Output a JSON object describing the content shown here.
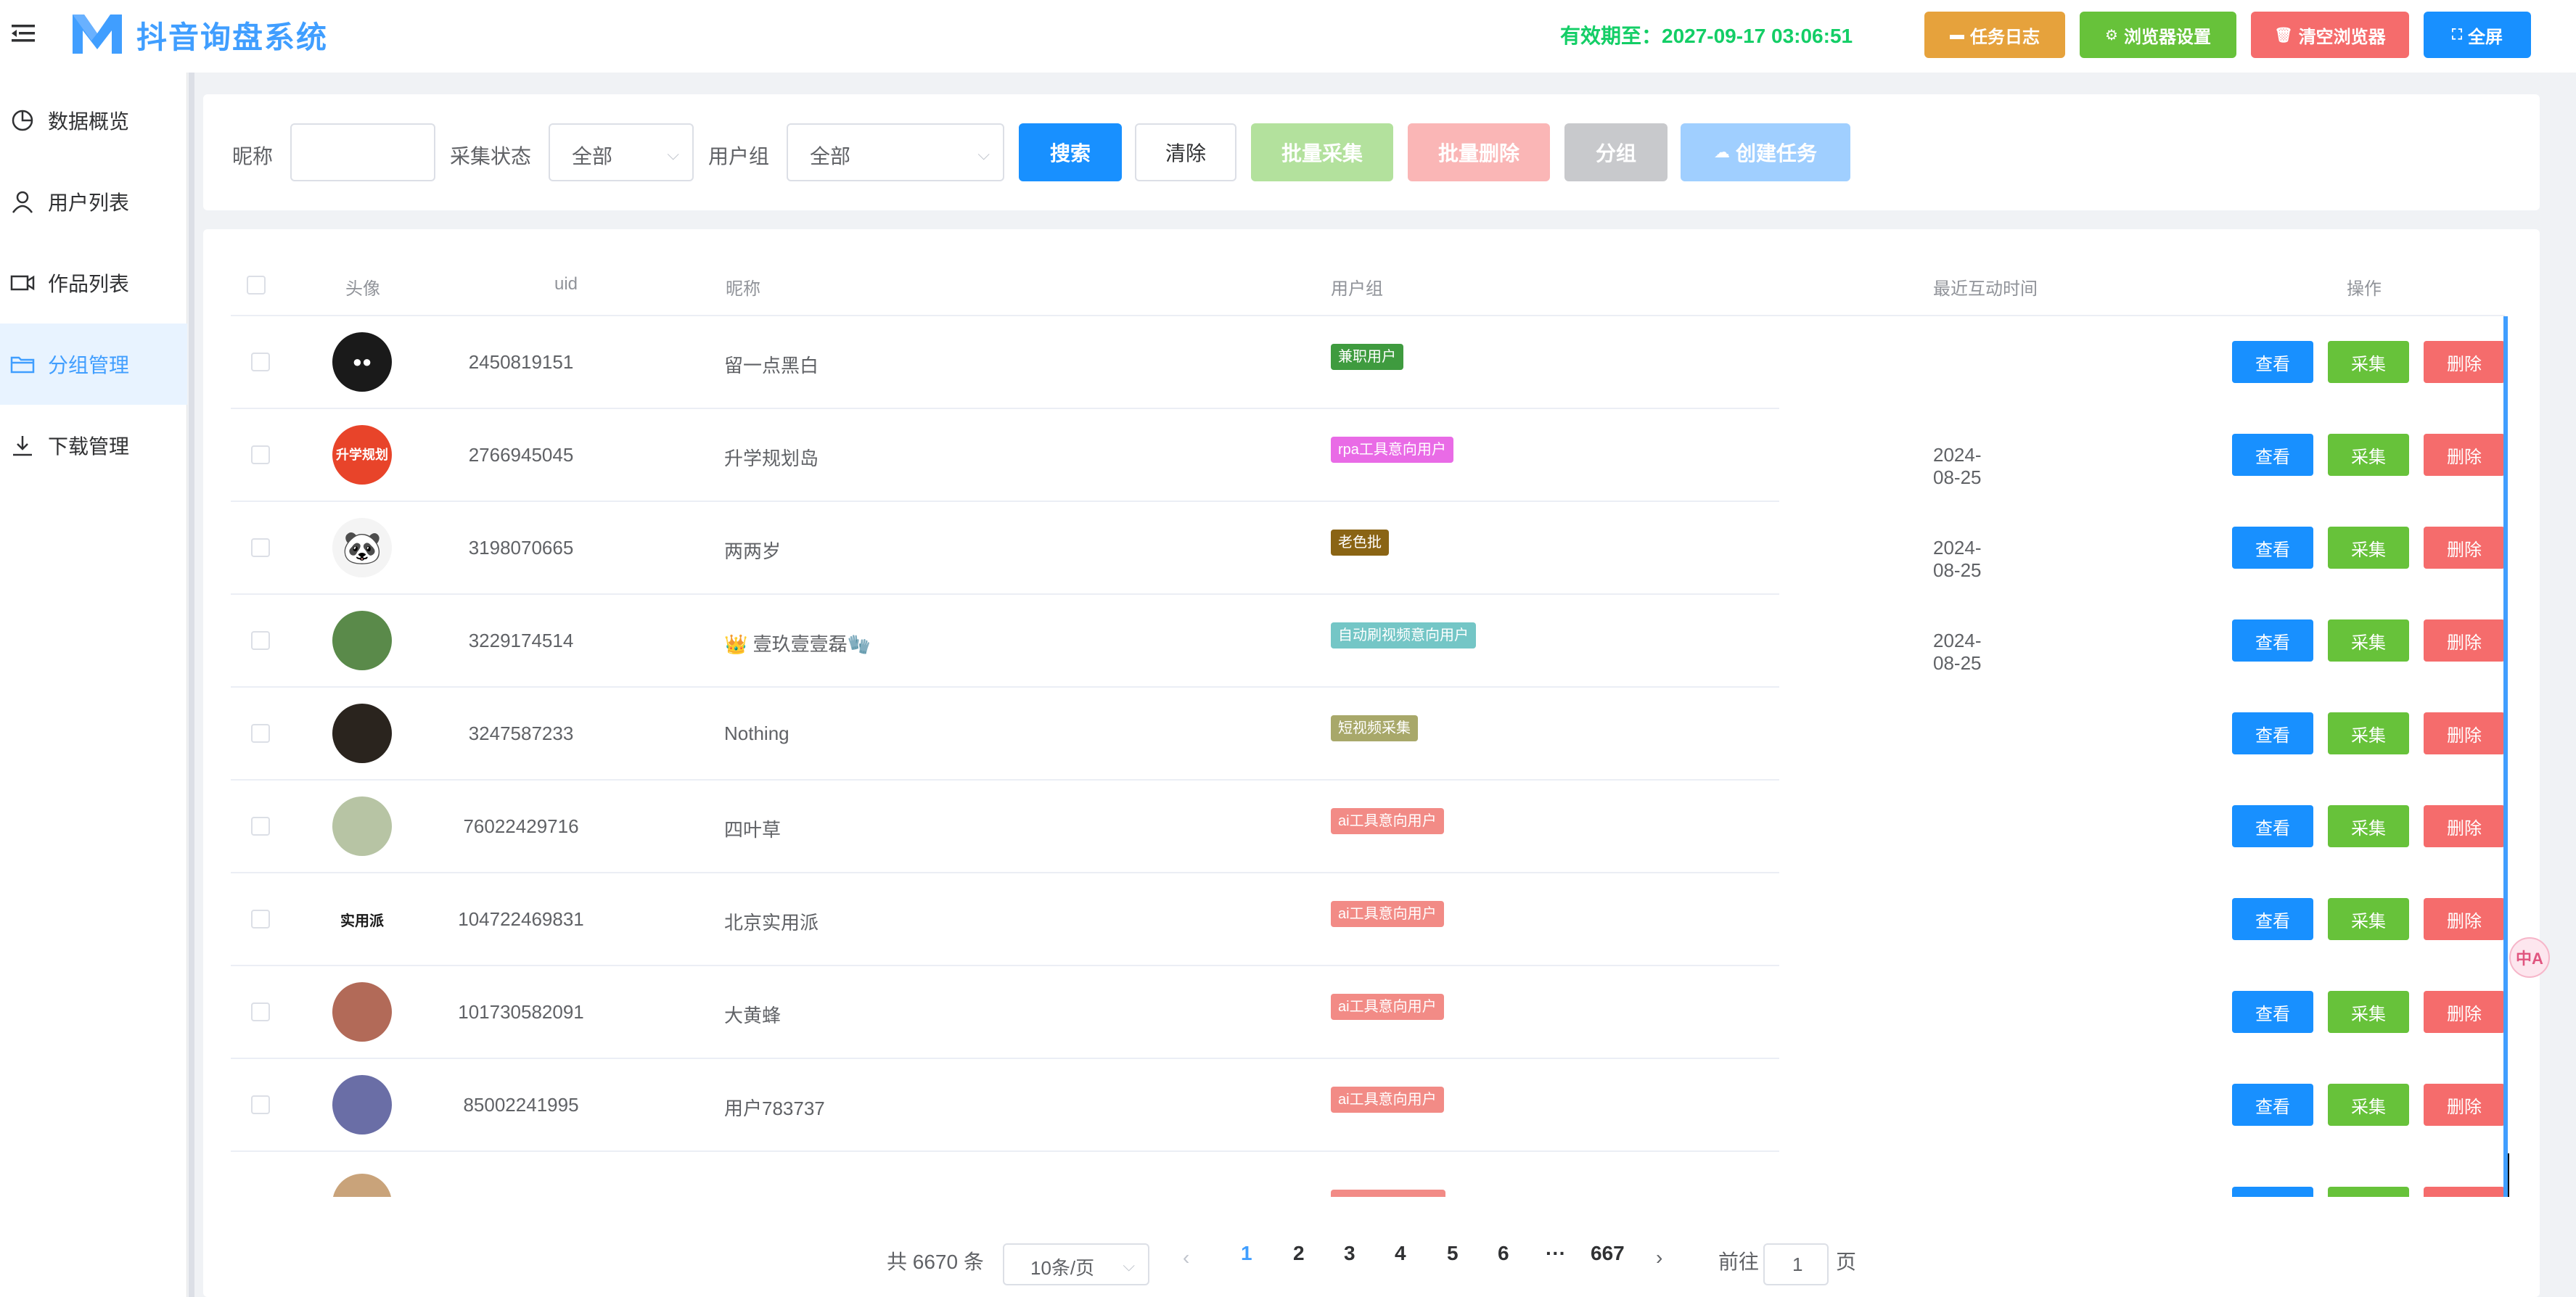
{
  "app": {
    "title": "抖音询盘系统",
    "expire_label": "有效期至：2027-09-17 03:06:51"
  },
  "header_buttons": [
    {
      "label": "任务日志",
      "icon": "monitor-icon",
      "color": "#e6a23c"
    },
    {
      "label": "浏览器设置",
      "icon": "gear-icon",
      "color": "#67c23a"
    },
    {
      "label": "清空浏览器",
      "icon": "trash-icon",
      "color": "#f56c6c"
    },
    {
      "label": "全屏",
      "icon": "fullscreen-icon",
      "color": "#1890ff"
    }
  ],
  "sidebar": {
    "items": [
      {
        "label": "数据概览",
        "icon": "pie-chart-icon"
      },
      {
        "label": "用户列表",
        "icon": "user-icon"
      },
      {
        "label": "作品列表",
        "icon": "video-icon"
      },
      {
        "label": "分组管理",
        "icon": "folder-icon",
        "active": true
      },
      {
        "label": "下载管理",
        "icon": "download-icon"
      }
    ]
  },
  "filters": {
    "nickname_label": "昵称",
    "nickname_value": "",
    "status_label": "采集状态",
    "status_value": "全部",
    "group_label": "用户组",
    "group_value": "全部",
    "search": "搜索",
    "clear": "清除",
    "batch_collect": "批量采集",
    "batch_delete": "批量删除",
    "group": "分组",
    "create_task": "创建任务"
  },
  "table": {
    "columns": [
      "头像",
      "uid",
      "昵称",
      "用户组",
      "最近互动时间",
      "操作"
    ],
    "actions": {
      "view": "查看",
      "collect": "采集",
      "delete": "删除"
    },
    "rows": [
      {
        "uid": "2450819151",
        "nick": "留一点黑白",
        "tag": "兼职用户",
        "tag_color": "#3f9b3f",
        "time": "",
        "avatar_bg": "#1a1a1a",
        "avatar_text": "●●"
      },
      {
        "uid": "2766945045",
        "nick": "升学规划岛",
        "tag": "rpa工具意向用户",
        "tag_color": "#e96be6",
        "time": "2024-08-25",
        "avatar_bg": "#e8442a",
        "avatar_text": "升学规划"
      },
      {
        "uid": "3198070665",
        "nick": "两两岁",
        "tag": "老色批",
        "tag_color": "#8a6414",
        "time": "2024-08-25",
        "avatar_bg": "#f4f4f4",
        "avatar_text": "🐼"
      },
      {
        "uid": "3229174514",
        "nick": "👑 壹玖壹壹磊🧤",
        "tag": "自动刷视频意向用户",
        "tag_color": "#74c6c6",
        "time": "2024-08-25",
        "avatar_bg": "#5a8a4a",
        "avatar_text": ""
      },
      {
        "uid": "3247587233",
        "nick": "Nothing",
        "tag": "短视频采集",
        "tag_color": "#a8a86a",
        "time": "",
        "avatar_bg": "#2a241e",
        "avatar_text": ""
      },
      {
        "uid": "76022429716",
        "nick": "四叶草",
        "tag": "ai工具意向用户",
        "tag_color": "#f28b86",
        "time": "",
        "avatar_bg": "#b7c4a4",
        "avatar_text": ""
      },
      {
        "uid": "104722469831",
        "nick": "北京实用派",
        "tag": "ai工具意向用户",
        "tag_color": "#f28b86",
        "time": "",
        "avatar_bg": "#f2d43a",
        "avatar_text": "实用派"
      },
      {
        "uid": "101730582091",
        "nick": "大黄蜂",
        "tag": "ai工具意向用户",
        "tag_color": "#f28b86",
        "time": "",
        "avatar_bg": "#b26a58",
        "avatar_text": ""
      },
      {
        "uid": "85002241995",
        "nick": "用户783737",
        "tag": "ai工具意向用户",
        "tag_color": "#f28b86",
        "time": "",
        "avatar_bg": "#6a6ea6",
        "avatar_text": ""
      }
    ]
  },
  "pagination": {
    "total": "共 6670 条",
    "page_size": "10条/页",
    "pages": [
      "1",
      "2",
      "3",
      "4",
      "5",
      "6",
      "···",
      "667"
    ],
    "current": "1",
    "goto_label": "前往",
    "goto_value": "1",
    "page_suffix": "页"
  },
  "colors": {
    "primary": "#1890ff",
    "success": "#67c23a",
    "danger": "#f56c6c",
    "warning": "#e6a23c"
  }
}
